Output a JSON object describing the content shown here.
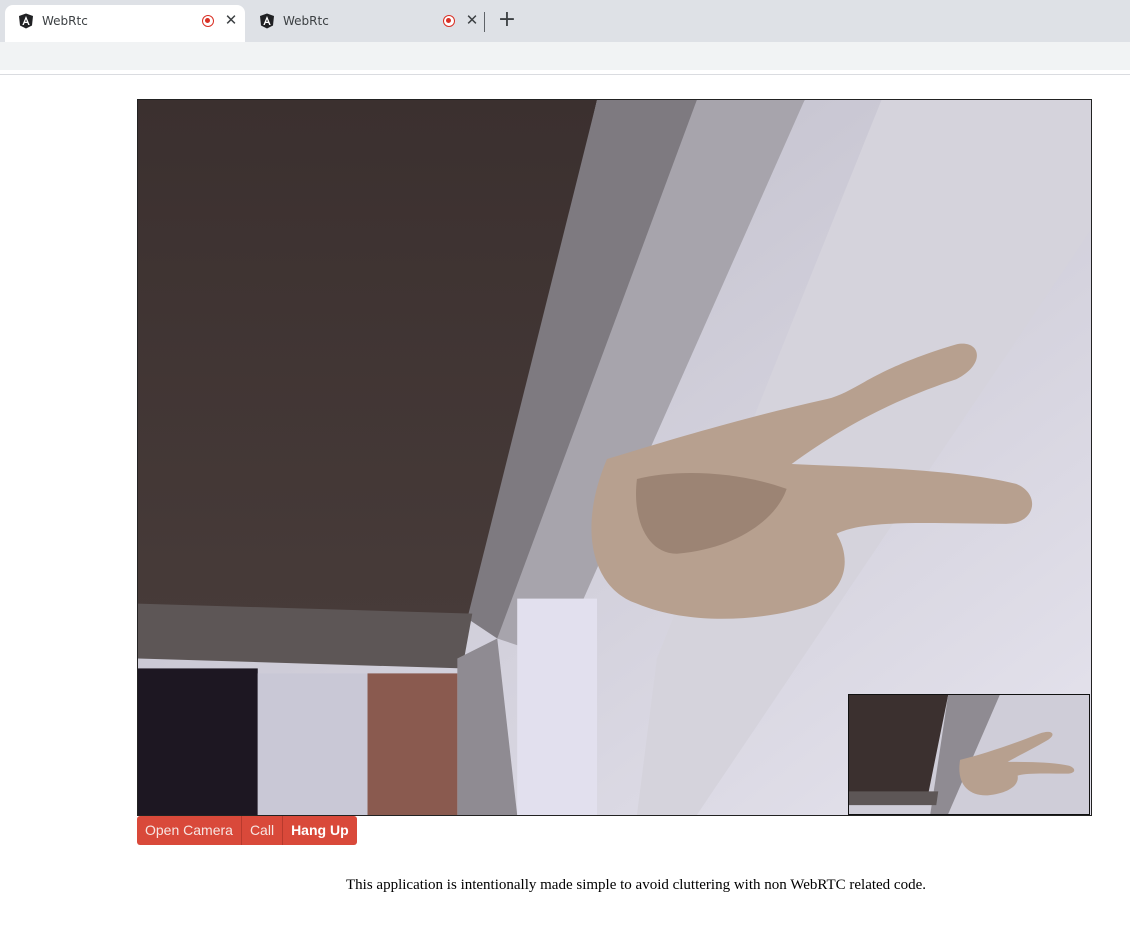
{
  "browser": {
    "tabs": [
      {
        "title": "WebRtc",
        "active": true,
        "icon": "angular-icon",
        "recording": true
      },
      {
        "title": "WebRtc",
        "active": false,
        "icon": "angular-icon",
        "recording": true
      }
    ],
    "new_tab_label": "+",
    "close_label": "✕"
  },
  "main": {
    "remote_video": {
      "icon": "video-feed"
    },
    "local_video": {
      "icon": "video-feed"
    },
    "buttons": {
      "open_camera": "Open Camera",
      "call": "Call",
      "hang_up": "Hang Up"
    },
    "note": "This application is intentionally made simple to avoid cluttering with non WebRTC related code."
  },
  "colors": {
    "button_accent": "#d9493a",
    "recording_indicator": "#d93025"
  }
}
